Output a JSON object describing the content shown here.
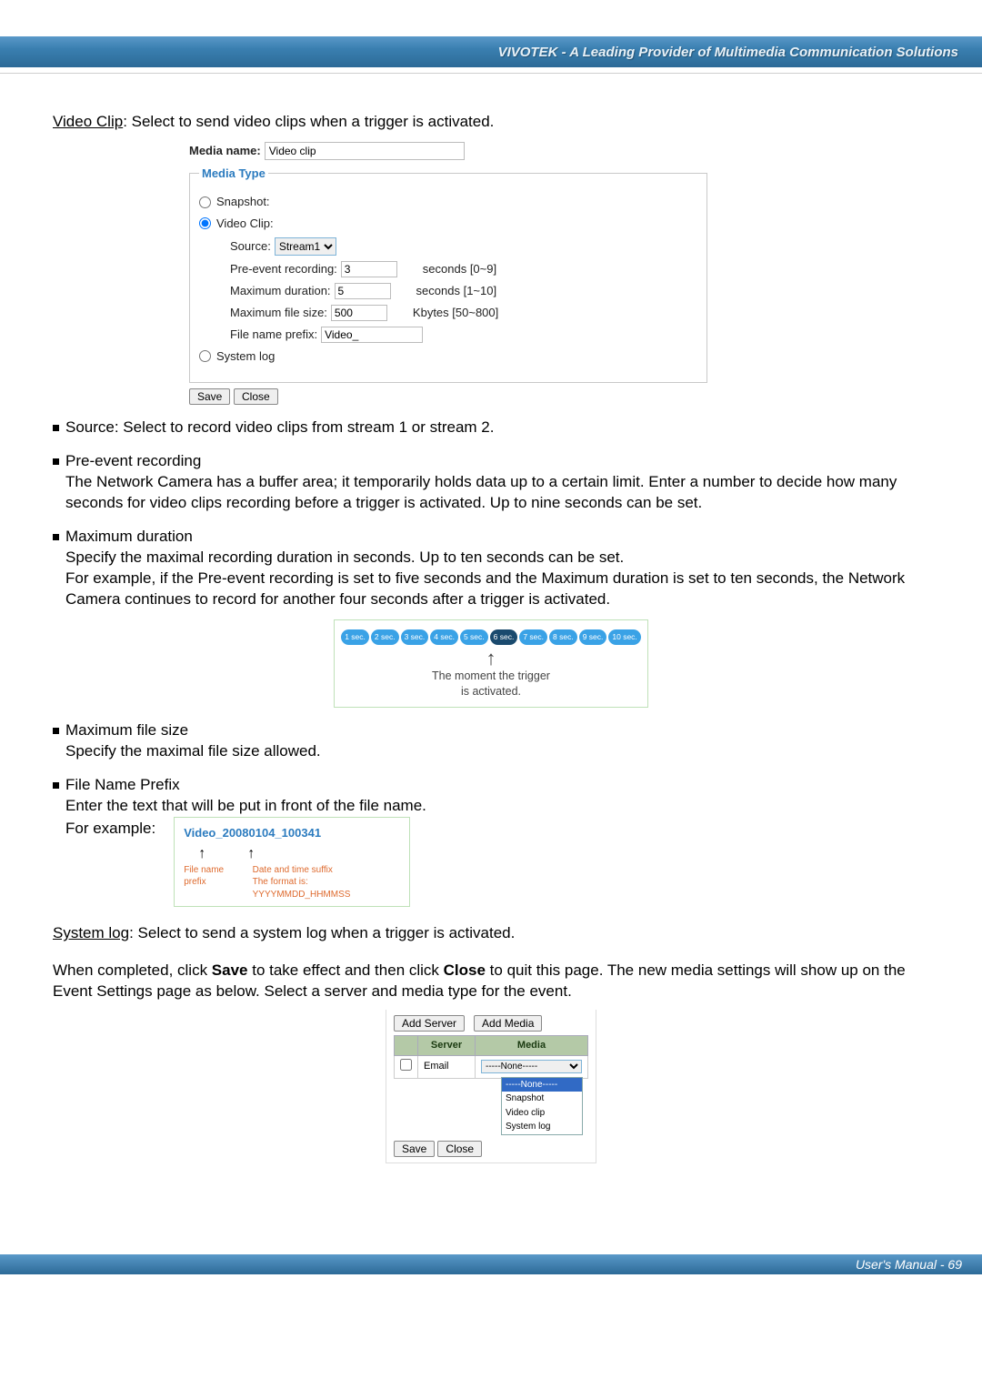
{
  "header": {
    "brand": "VIVOTEK - A Leading Provider of Multimedia Communication Solutions"
  },
  "intro": {
    "video_clip_label": "Video Clip",
    "video_clip_desc": ": Select to send video clips when a trigger is activated."
  },
  "media_form": {
    "media_name_label": "Media name:",
    "media_name_value": "Video clip",
    "legend": "Media Type",
    "snapshot": "Snapshot:",
    "video_clip": "Video Clip:",
    "system_log": "System log",
    "source_label": "Source:",
    "source_value": "Stream1",
    "pre_event_label": "Pre-event recording:",
    "pre_event_value": "3",
    "pre_event_suffix": "seconds [0~9]",
    "max_dur_label": "Maximum duration:",
    "max_dur_value": "5",
    "max_dur_suffix": "seconds [1~10]",
    "max_size_label": "Maximum file size:",
    "max_size_value": "500",
    "max_size_suffix": "Kbytes [50~800]",
    "file_prefix_label": "File name prefix:",
    "file_prefix_value": "Video_",
    "save": "Save",
    "close": "Close"
  },
  "bullets": {
    "source": "Source: Select to record video clips from stream 1 or stream 2.",
    "pre_event_h": "Pre-event recording",
    "pre_event_body": "The Network Camera has a buffer area; it temporarily holds data up to a certain limit. Enter a number to decide how many seconds for video clips recording before a trigger is activated. Up to nine seconds can be set.",
    "max_dur_h": "Maximum duration",
    "max_dur_l1": "Specify the maximal recording duration in seconds. Up to ten seconds can be set.",
    "max_dur_l2": "For example, if the Pre-event recording is set to five seconds and the Maximum duration is set to ten seconds, the Network Camera continues to record for another four seconds after a trigger is activated.",
    "max_size_h": "Maximum file size",
    "max_size_body": "Specify the maximal file size allowed.",
    "prefix_h": "File Name Prefix",
    "prefix_body": "Enter the text that will be put in front of the file name.",
    "prefix_example": "For example:"
  },
  "timeline": {
    "pills": [
      "1 sec.",
      "2 sec.",
      "3 sec.",
      "4 sec.",
      "5 sec.",
      "6 sec.",
      "7 sec.",
      "8 sec.",
      "9 sec.",
      "10 sec."
    ],
    "caption1": "The moment the trigger",
    "caption2": "is activated."
  },
  "prefix_box": {
    "filename": "Video_20080104_100341",
    "lbl_prefix": "File name prefix",
    "lbl_suffix1": "Date and time suffix",
    "lbl_suffix2": "The format is: YYYYMMDD_HHMMSS"
  },
  "system_log": {
    "label": "System log",
    "desc": ": Select to send a system log when a trigger is activated."
  },
  "closing": {
    "p1a": "When completed, click ",
    "save": "Save",
    "p1b": " to take effect and then click ",
    "close": "Close",
    "p1c": " to quit this page. The new media settings will show up on the Event Settings page as below. Select a server and media type for the event."
  },
  "event_mini": {
    "add_server": "Add Server",
    "add_media": "Add Media",
    "th_server": "Server",
    "th_media": "Media",
    "row_email": "Email",
    "none": "-----None-----",
    "opts": [
      "-----None-----",
      "Snapshot",
      "Video clip",
      "System log"
    ],
    "save": "Save",
    "close": "Close"
  },
  "footer": {
    "text": "User's Manual - 69"
  }
}
